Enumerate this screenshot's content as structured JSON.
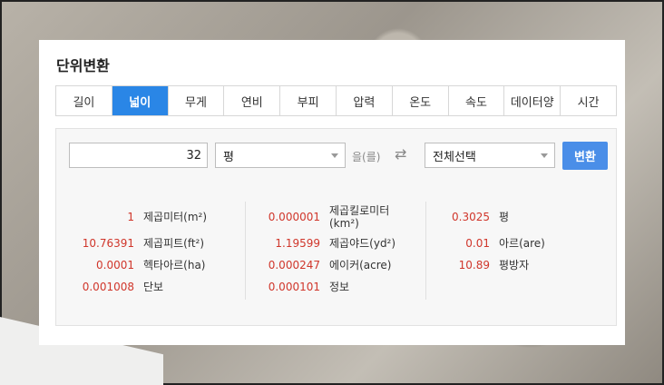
{
  "title": "단위변환",
  "tabs": [
    "길이",
    "넓이",
    "무게",
    "연비",
    "부피",
    "압력",
    "온도",
    "속도",
    "데이터양",
    "시간"
  ],
  "active_tab": 1,
  "form": {
    "value": "32",
    "from_unit": "평",
    "particle": "을(를)",
    "swap_icon": "swap-arrows-icon",
    "to_unit": "전체선택",
    "convert_label": "변환"
  },
  "results": {
    "col1": [
      {
        "value": "1",
        "unit": "제곱미터(m²)"
      },
      {
        "value": "10.76391",
        "unit": "제곱피트(ft²)"
      },
      {
        "value": "0.0001",
        "unit": "헥타아르(ha)"
      },
      {
        "value": "0.001008",
        "unit": "단보"
      }
    ],
    "col2": [
      {
        "value": "0.000001",
        "unit": "제곱킬로미터(km²)"
      },
      {
        "value": "1.19599",
        "unit": "제곱야드(yd²)"
      },
      {
        "value": "0.000247",
        "unit": "에이커(acre)"
      },
      {
        "value": "0.000101",
        "unit": "정보"
      }
    ],
    "col3": [
      {
        "value": "0.3025",
        "unit": "평"
      },
      {
        "value": "0.01",
        "unit": "아르(are)"
      },
      {
        "value": "10.89",
        "unit": "평방자"
      }
    ]
  },
  "colors": {
    "accent": "#2a86e6",
    "value": "#d0362b",
    "button": "#4a8ee8"
  }
}
